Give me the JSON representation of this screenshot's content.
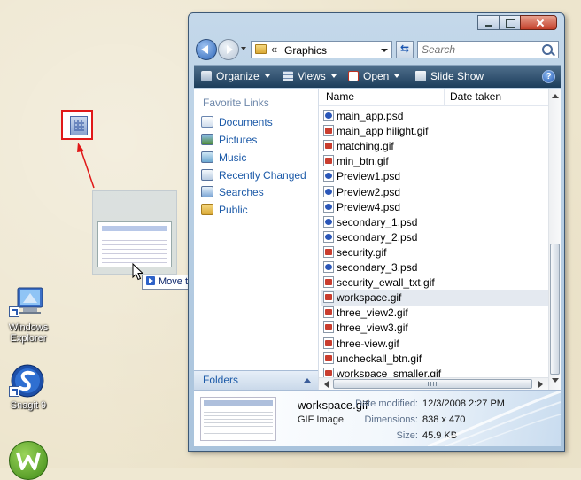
{
  "desktop": {
    "icons": [
      {
        "label_lines": [
          "Windows",
          "Explorer"
        ]
      },
      {
        "label_lines": [
          "Snagit 9"
        ]
      }
    ],
    "tooltip_text": "Move to Desktop",
    "annotation_color": "#e01818"
  },
  "window": {
    "address": {
      "separator": "«",
      "path": "Graphics"
    },
    "search": {
      "placeholder": "Search"
    },
    "toolbar": {
      "organize": "Organize",
      "views": "Views",
      "open": "Open",
      "slideshow": "Slide Show",
      "help": "?"
    },
    "navpane": {
      "header": "Favorite Links",
      "links": [
        "Documents",
        "Pictures",
        "Music",
        "Recently Changed",
        "Searches",
        "Public"
      ],
      "folders_label": "Folders"
    },
    "columns": {
      "name": "Name",
      "date": "Date taken"
    },
    "files": [
      {
        "name": "main_app.psd",
        "kind": "psd"
      },
      {
        "name": "main_app hilight.gif",
        "kind": "gif"
      },
      {
        "name": "matching.gif",
        "kind": "gif"
      },
      {
        "name": "min_btn.gif",
        "kind": "gif"
      },
      {
        "name": "Preview1.psd",
        "kind": "psd"
      },
      {
        "name": "Preview2.psd",
        "kind": "psd"
      },
      {
        "name": "Preview4.psd",
        "kind": "psd"
      },
      {
        "name": "secondary_1.psd",
        "kind": "psd"
      },
      {
        "name": "secondary_2.psd",
        "kind": "psd"
      },
      {
        "name": "security.gif",
        "kind": "gif"
      },
      {
        "name": "secondary_3.psd",
        "kind": "psd"
      },
      {
        "name": "security_ewall_txt.gif",
        "kind": "gif"
      },
      {
        "name": "workspace.gif",
        "kind": "gif",
        "selected": true
      },
      {
        "name": "three_view2.gif",
        "kind": "gif"
      },
      {
        "name": "three_view3.gif",
        "kind": "gif"
      },
      {
        "name": "three-view.gif",
        "kind": "gif"
      },
      {
        "name": "uncheckall_btn.gif",
        "kind": "gif"
      },
      {
        "name": "workspace_smaller.gif",
        "kind": "gif"
      }
    ],
    "details": {
      "name": "workspace.gif",
      "type": "GIF Image",
      "date_label": "Date modified:",
      "date_value": "12/3/2008 2:27 PM",
      "dim_label": "Dimensions:",
      "dim_value": "838 x 470",
      "size_label": "Size:",
      "size_value": "45.9 KB"
    }
  }
}
